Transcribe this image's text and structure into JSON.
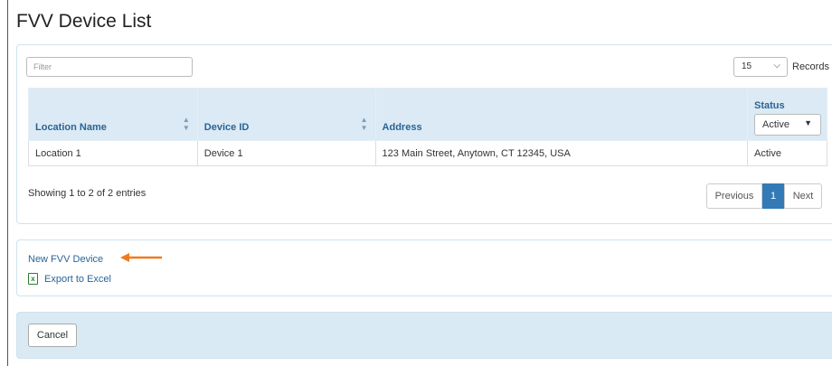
{
  "page": {
    "title": "FVV Device List"
  },
  "filter": {
    "placeholder": "Filter"
  },
  "records": {
    "value": "15",
    "label": "Records"
  },
  "table": {
    "headers": {
      "location_name": "Location Name",
      "device_id": "Device ID",
      "address": "Address",
      "status": "Status"
    },
    "status_filter": "Active",
    "rows": [
      {
        "location_name": "Location 1",
        "device_id": "Device 1",
        "address": "123 Main Street, Anytown, CT 12345, USA",
        "status": "Active"
      }
    ]
  },
  "pagination": {
    "showing": "Showing 1 to 2 of 2 entries",
    "previous": "Previous",
    "current": "1",
    "next": "Next"
  },
  "links": {
    "new_device": "New FVV Device",
    "export": "Export to Excel",
    "export_icon": "excel-icon"
  },
  "footer": {
    "cancel": "Cancel"
  },
  "colors": {
    "accent": "#337ab7",
    "header_bg": "#dbeaf4",
    "arrow": "#f07a1f"
  }
}
